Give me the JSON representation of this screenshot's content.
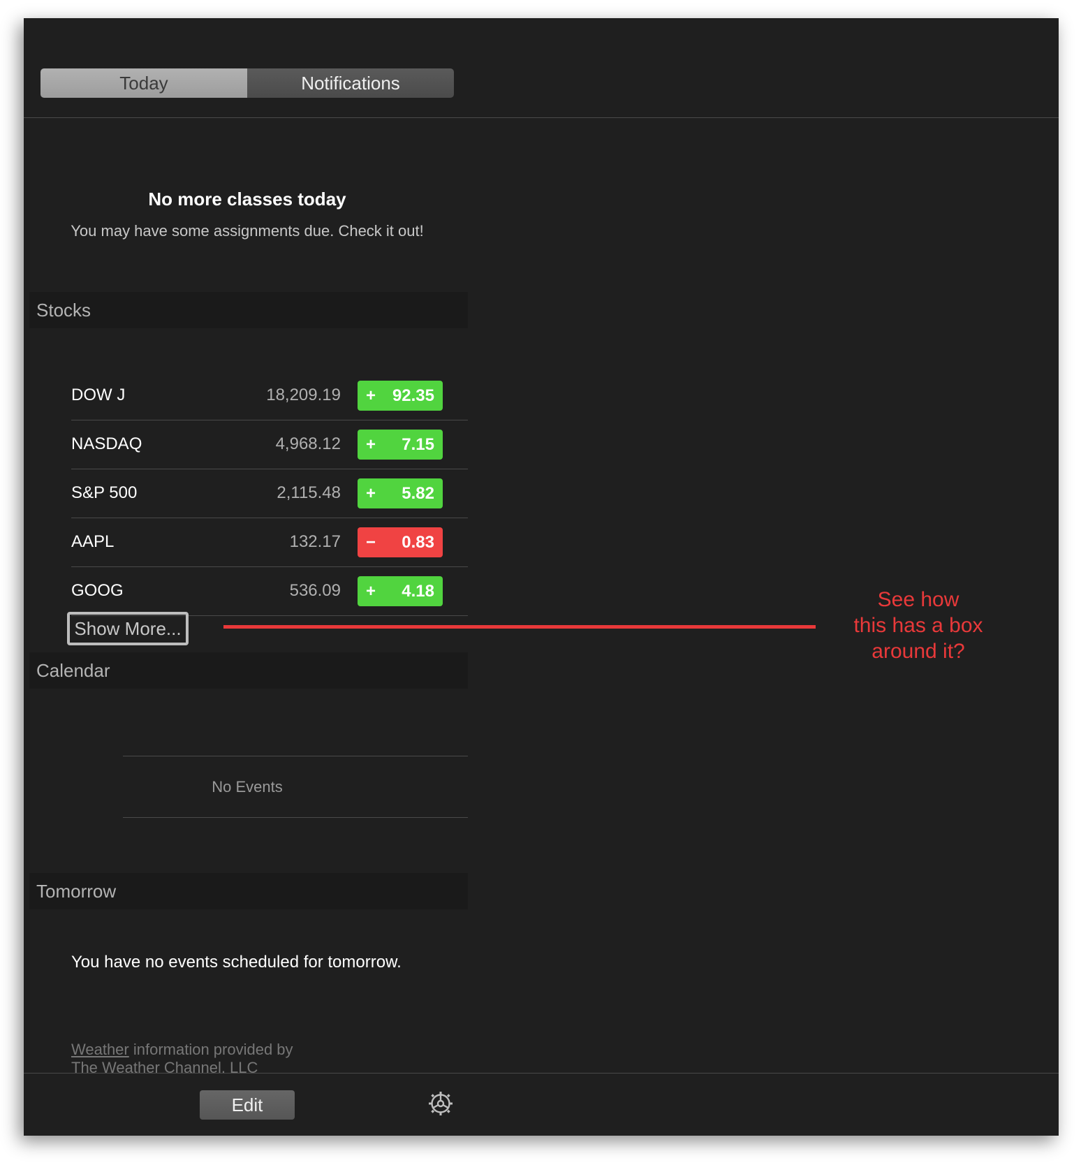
{
  "tabs": {
    "today": "Today",
    "notifications": "Notifications"
  },
  "classes_widget": {
    "title": "No more classes today",
    "subtitle": "You may have some assignments due. Check it out!"
  },
  "stocks": {
    "header": "Stocks",
    "rows": [
      {
        "name": "DOW J",
        "price": "18,209.19",
        "sign": "+",
        "change": "92.35",
        "direction": "up"
      },
      {
        "name": "NASDAQ",
        "price": "4,968.12",
        "sign": "+",
        "change": "7.15",
        "direction": "up"
      },
      {
        "name": "S&P 500",
        "price": "2,115.48",
        "sign": "+",
        "change": "5.82",
        "direction": "up"
      },
      {
        "name": "AAPL",
        "price": "132.17",
        "sign": "−",
        "change": "0.83",
        "direction": "down"
      },
      {
        "name": "GOOG",
        "price": "536.09",
        "sign": "+",
        "change": "4.18",
        "direction": "up"
      }
    ],
    "show_more": "Show More..."
  },
  "calendar": {
    "header": "Calendar",
    "empty_text": "No Events"
  },
  "tomorrow": {
    "header": "Tomorrow",
    "text": "You have no events scheduled for tomorrow."
  },
  "weather_credit": {
    "link": "Weather",
    "line1_rest": " information provided by",
    "line2": "The Weather Channel, LLC"
  },
  "footer": {
    "edit_label": "Edit",
    "settings_icon": "gear-icon"
  },
  "annotation": {
    "text": "See how\nthis has a box\naround it?",
    "color": "#e9393a"
  },
  "colors": {
    "up": "#51d43f",
    "down": "#f04343",
    "panel_bg": "#1f1f1f"
  }
}
